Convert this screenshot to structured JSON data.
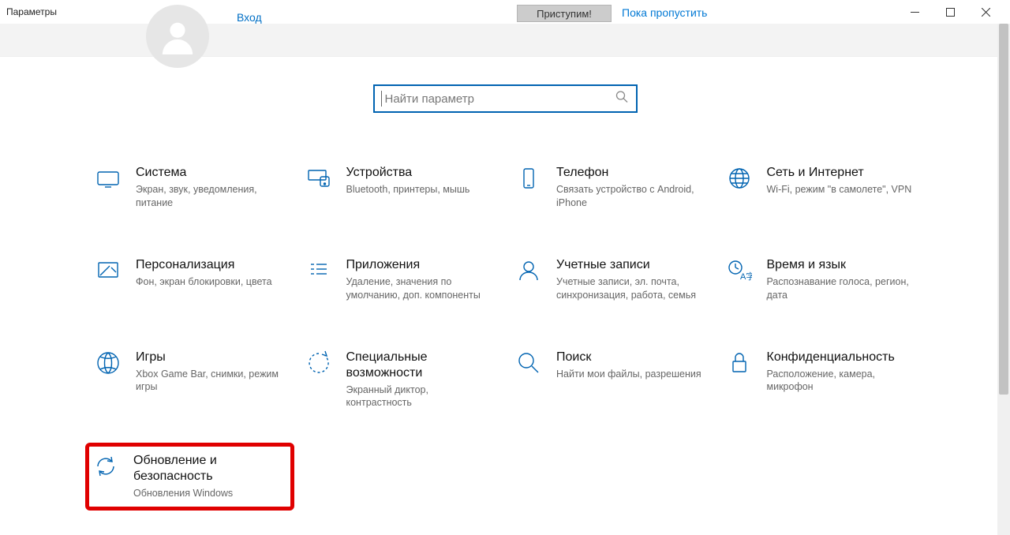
{
  "window": {
    "title": "Параметры"
  },
  "banner": {
    "signin": "Вход",
    "getstarted": "Приступим!",
    "skip": "Пока пропустить"
  },
  "search": {
    "placeholder": "Найти параметр"
  },
  "tiles": {
    "system": {
      "title": "Система",
      "desc": "Экран, звук, уведомления, питание"
    },
    "devices": {
      "title": "Устройства",
      "desc": "Bluetooth, принтеры, мышь"
    },
    "phone": {
      "title": "Телефон",
      "desc": "Связать устройство с Android, iPhone"
    },
    "network": {
      "title": "Сеть и Интернет",
      "desc": "Wi-Fi, режим \"в самолете\", VPN"
    },
    "personalization": {
      "title": "Персонализация",
      "desc": "Фон, экран блокировки, цвета"
    },
    "apps": {
      "title": "Приложения",
      "desc": "Удаление, значения по умолчанию, доп. компоненты"
    },
    "accounts": {
      "title": "Учетные записи",
      "desc": "Учетные записи, эл. почта, синхронизация, работа, семья"
    },
    "time": {
      "title": "Время и язык",
      "desc": "Распознавание голоса, регион, дата"
    },
    "gaming": {
      "title": "Игры",
      "desc": "Xbox Game Bar, снимки, режим игры"
    },
    "ease": {
      "title": "Специальные возможности",
      "desc": "Экранный диктор, контрастность"
    },
    "searchcat": {
      "title": "Поиск",
      "desc": "Найти мои файлы, разрешения"
    },
    "privacy": {
      "title": "Конфиденциальность",
      "desc": "Расположение, камера, микрофон"
    },
    "update": {
      "title": "Обновление и безопасность",
      "desc": "Обновления Windows"
    }
  }
}
